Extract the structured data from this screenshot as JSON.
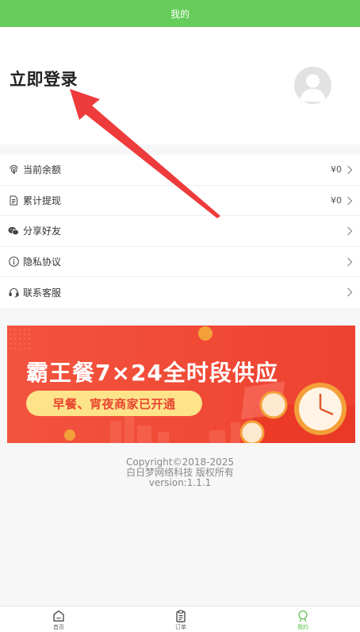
{
  "header": {
    "title": "我的"
  },
  "profile": {
    "login_label": "立即登录"
  },
  "menu": {
    "items": [
      {
        "label": "当前余额",
        "value": "¥0",
        "icon": "fingerprint-icon"
      },
      {
        "label": "累计提现",
        "value": "¥0",
        "icon": "document-icon"
      },
      {
        "label": "分享好友",
        "value": "",
        "icon": "wechat-icon"
      },
      {
        "label": "隐私协议",
        "value": "",
        "icon": "info-icon"
      },
      {
        "label": "联系客服",
        "value": "",
        "icon": "headset-icon"
      }
    ]
  },
  "banner": {
    "title": "霸王餐7×24全时段供应",
    "subtitle": "早餐、宵夜商家已开通"
  },
  "footer": {
    "copyright": "Copyright©2018-2025",
    "company": "白日梦网络科技 版权所有",
    "version": "version:1.1.1"
  },
  "tabbar": {
    "tabs": [
      {
        "label": "首页",
        "icon": "home-icon",
        "active": false
      },
      {
        "label": "订单",
        "icon": "clipboard-icon",
        "active": false
      },
      {
        "label": "我的",
        "icon": "profile-icon",
        "active": true
      }
    ]
  },
  "colors": {
    "accent": "#66cc5a",
    "banner_red": "#f04a36",
    "annotation_arrow": "#ee3b3b"
  }
}
